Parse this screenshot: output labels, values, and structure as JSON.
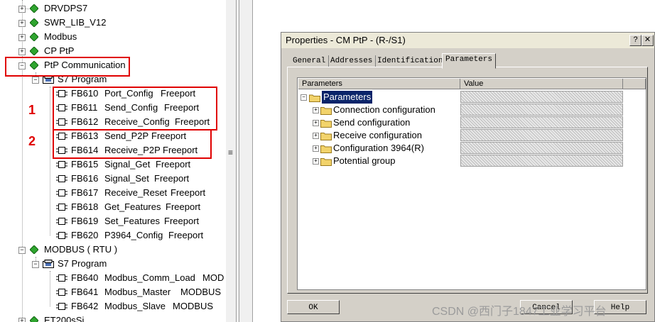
{
  "tree": {
    "libraries": [
      "DRVDPS7",
      "SWR_LIB_V12",
      "Modbus",
      "CP PtP",
      "PtP Communication"
    ],
    "ptp_program": "S7 Program",
    "ptp_blocks": [
      {
        "name": "FB610",
        "func": "Port_Config",
        "family": "Freeport"
      },
      {
        "name": "FB611",
        "func": "Send_Config",
        "family": "Freeport"
      },
      {
        "name": "FB612",
        "func": "Receive_Config",
        "family": "Freeport"
      },
      {
        "name": "FB613",
        "func": "Send_P2P",
        "family": "Freeport"
      },
      {
        "name": "FB614",
        "func": "Receive_P2P",
        "family": "Freeport"
      },
      {
        "name": "FB615",
        "func": "Signal_Get",
        "family": "Freeport"
      },
      {
        "name": "FB616",
        "func": "Signal_Set",
        "family": "Freeport"
      },
      {
        "name": "FB617",
        "func": "Receive_Reset",
        "family": "Freeport"
      },
      {
        "name": "FB618",
        "func": "Get_Features",
        "family": "Freeport"
      },
      {
        "name": "FB619",
        "func": "Set_Features",
        "family": "Freeport"
      },
      {
        "name": "FB620",
        "func": "P3964_Config",
        "family": "Freeport"
      }
    ],
    "modbus_library": "MODBUS ( RTU )",
    "modbus_program": "S7 Program",
    "modbus_blocks": [
      {
        "name": "FB640",
        "func": "Modbus_Comm_Load",
        "family": "MOD"
      },
      {
        "name": "FB641",
        "func": "Modbus_Master",
        "family": "MODBUS"
      },
      {
        "name": "FB642",
        "func": "Modbus_Slave",
        "family": "MODBUS"
      }
    ],
    "last_partial": "ET200sSi",
    "annotations": [
      "1",
      "2"
    ]
  },
  "dialog": {
    "title": "Properties - CM PtP - (R-/S1)",
    "tabs": [
      "General",
      "Addresses",
      "Identification",
      "Parameters"
    ],
    "active_tab": "Parameters",
    "columns": [
      "Parameters",
      "Value"
    ],
    "root": "Parameters",
    "items": [
      "Connection configuration",
      "Send configuration",
      "Receive configuration",
      "Configuration 3964(R)",
      "Potential group"
    ],
    "buttons": {
      "ok": "OK",
      "cancel": "Cancel",
      "help": "Help"
    }
  },
  "watermark": "CSDN @西门子1847工业学习平台",
  "colors": {
    "annotation_red": "#e00000",
    "selection": "#0a246a",
    "library_green": "#2fa52f",
    "folder_yellow": "#f2d36b"
  }
}
